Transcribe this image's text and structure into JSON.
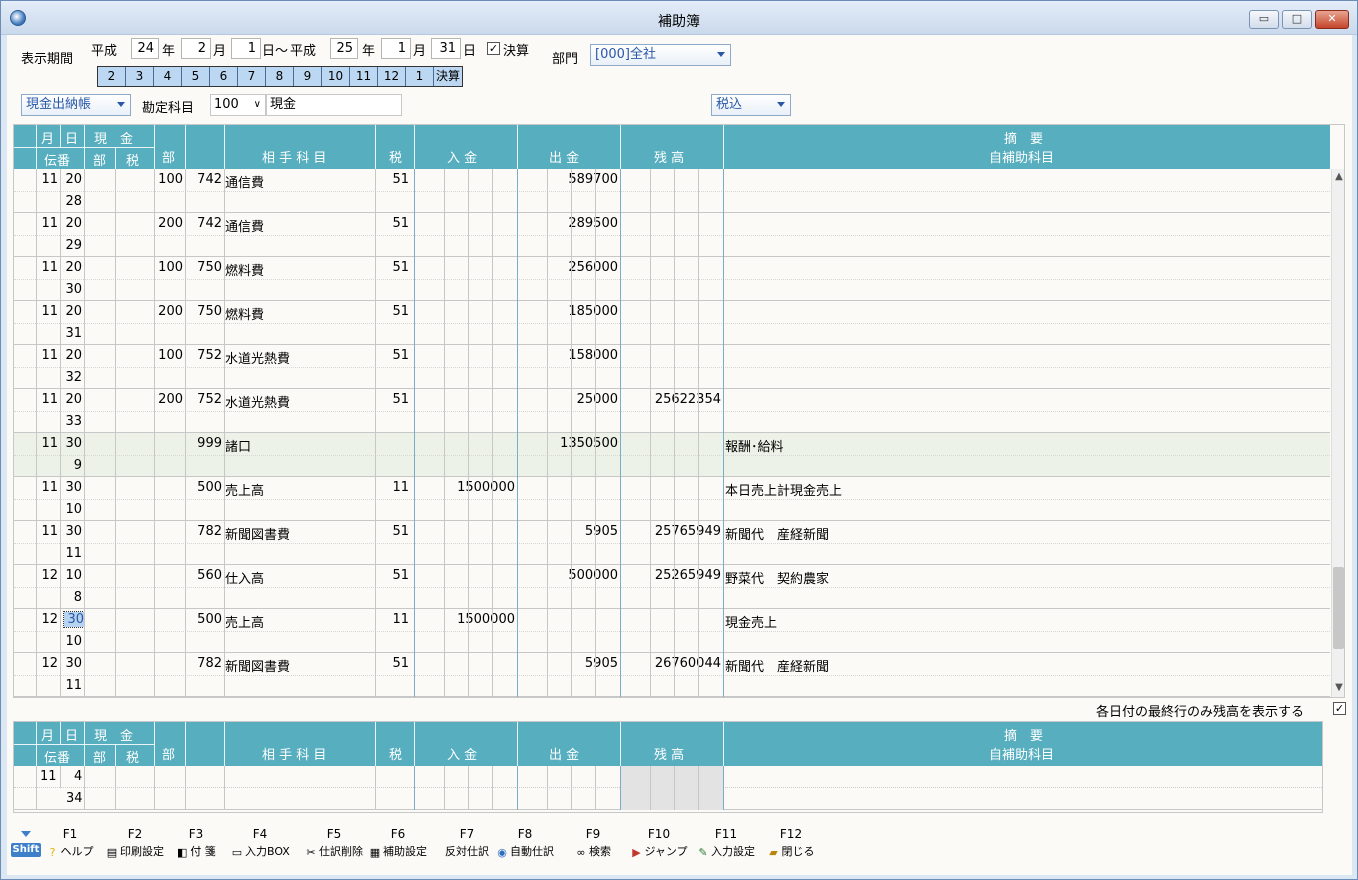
{
  "window": {
    "title": "補助簿",
    "min": "▭",
    "max": "□",
    "close": "✕"
  },
  "period": {
    "label": "表示期間",
    "era1": "平成",
    "year1": "24",
    "nen1": "年",
    "month1": "2",
    "tsuki1": "月",
    "day1": "1",
    "nichi1": "日～",
    "era2": "平成",
    "year2": "25",
    "nen2": "年",
    "month2": "1",
    "tsuki2": "月",
    "day2": "31",
    "nichi2": "日",
    "kessan_checked": true,
    "kessan_label": "決算"
  },
  "month_tabs": [
    "2",
    "3",
    "4",
    "5",
    "6",
    "7",
    "8",
    "9",
    "10",
    "11",
    "12",
    "1",
    "決算"
  ],
  "dept": {
    "label": "部門",
    "value": "[000]全社"
  },
  "book_type": "現金出納帳",
  "account": {
    "label": "勘定科目",
    "code": "100",
    "name": "現金"
  },
  "tax_mode": "税込",
  "headers": {
    "month": "月",
    "day": "日",
    "genkin": "現　金",
    "denban": "伝番",
    "bu": "部",
    "zei": "税",
    "dept": "部",
    "aite": "相 手 科 目",
    "tax": "税",
    "nyukin": "入 金",
    "shukkin": "出 金",
    "zandaka": "残 高",
    "tekiyo": "摘　要",
    "hojo": "自補助科目"
  },
  "rows": [
    {
      "m": "11",
      "d": "20",
      "den": "28",
      "dept": "100",
      "code": "742",
      "name": "通信費",
      "tax": "51",
      "in": "",
      "out": "589700",
      "bal": "",
      "memo": ""
    },
    {
      "m": "11",
      "d": "20",
      "den": "29",
      "dept": "200",
      "code": "742",
      "name": "通信費",
      "tax": "51",
      "in": "",
      "out": "289500",
      "bal": "",
      "memo": ""
    },
    {
      "m": "11",
      "d": "20",
      "den": "30",
      "dept": "100",
      "code": "750",
      "name": "燃料費",
      "tax": "51",
      "in": "",
      "out": "256000",
      "bal": "",
      "memo": ""
    },
    {
      "m": "11",
      "d": "20",
      "den": "31",
      "dept": "200",
      "code": "750",
      "name": "燃料費",
      "tax": "51",
      "in": "",
      "out": "185000",
      "bal": "",
      "memo": ""
    },
    {
      "m": "11",
      "d": "20",
      "den": "32",
      "dept": "100",
      "code": "752",
      "name": "水道光熱費",
      "tax": "51",
      "in": "",
      "out": "158000",
      "bal": "",
      "memo": ""
    },
    {
      "m": "11",
      "d": "20",
      "den": "33",
      "dept": "200",
      "code": "752",
      "name": "水道光熱費",
      "tax": "51",
      "in": "",
      "out": "25000",
      "bal": "25622354",
      "memo": ""
    },
    {
      "m": "11",
      "d": "30",
      "den": "9",
      "dept": "",
      "code": "999",
      "name": "諸口",
      "tax": "",
      "in": "",
      "out": "1350500",
      "bal": "",
      "memo": "報酬･給料"
    },
    {
      "m": "11",
      "d": "30",
      "den": "10",
      "dept": "",
      "code": "500",
      "name": "売上高",
      "tax": "11",
      "in": "1500000",
      "out": "",
      "bal": "",
      "memo": "本日売上計現金売上"
    },
    {
      "m": "11",
      "d": "30",
      "den": "11",
      "dept": "",
      "code": "782",
      "name": "新聞図書費",
      "tax": "51",
      "in": "",
      "out": "5905",
      "bal": "25765949",
      "memo": "新聞代　産経新聞"
    },
    {
      "m": "12",
      "d": "10",
      "den": "8",
      "dept": "",
      "code": "560",
      "name": "仕入高",
      "tax": "51",
      "in": "",
      "out": "500000",
      "bal": "25265949",
      "memo": "野菜代　契約農家"
    },
    {
      "m": "12",
      "d": "30",
      "den": "10",
      "dept": "",
      "code": "500",
      "name": "売上高",
      "tax": "11",
      "in": "1500000",
      "out": "",
      "bal": "",
      "memo": "現金売上"
    },
    {
      "m": "12",
      "d": "30",
      "den": "11",
      "dept": "",
      "code": "782",
      "name": "新聞図書費",
      "tax": "51",
      "in": "",
      "out": "5905",
      "bal": "26760044",
      "memo": "新聞代　産経新聞"
    }
  ],
  "show_last_balance": {
    "label": "各日付の最終行のみ残高を表示する",
    "checked": true
  },
  "entry_row": {
    "m": "11",
    "d": "4",
    "den": "34"
  },
  "fkeys": [
    {
      "k": "F1",
      "t": "ヘルプ"
    },
    {
      "k": "F2",
      "t": "印刷設定"
    },
    {
      "k": "F3",
      "t": "付 箋"
    },
    {
      "k": "F4",
      "t": "入力BOX"
    },
    {
      "k": "F5",
      "t": "仕訳削除"
    },
    {
      "k": "F6",
      "t": "補助設定"
    },
    {
      "k": "F7",
      "t": "反対仕訳"
    },
    {
      "k": "F8",
      "t": "自動仕訳"
    },
    {
      "k": "F9",
      "t": "検索"
    },
    {
      "k": "F10",
      "t": "ジャンプ"
    },
    {
      "k": "F11",
      "t": "入力設定"
    },
    {
      "k": "F12",
      "t": "閉じる"
    }
  ],
  "shift_label": "Shift",
  "colors": {
    "header": "#56aebf",
    "selected_row": "#ecf2e8",
    "accent": "#2a58a8"
  }
}
